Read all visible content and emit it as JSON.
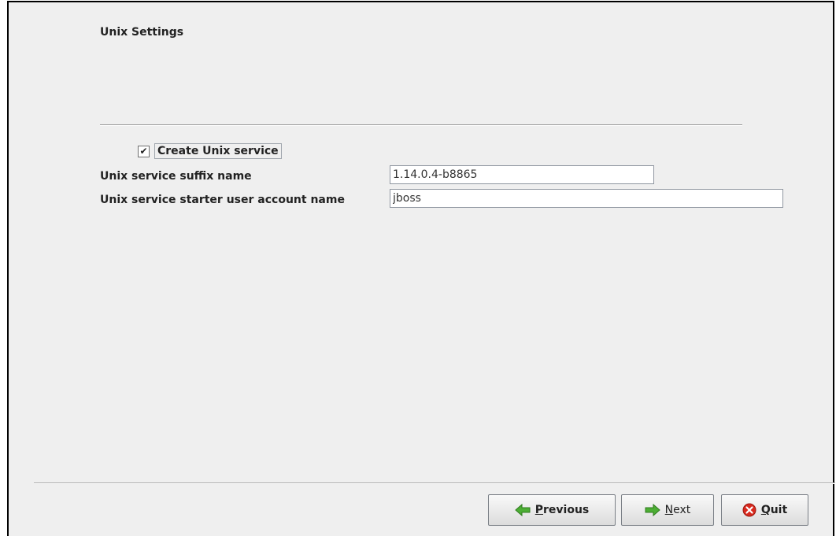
{
  "panel": {
    "title": "Unix Settings"
  },
  "create_service": {
    "checked": true,
    "check_glyph": "✔",
    "label": "Create Unix service"
  },
  "suffix": {
    "label": "Unix service suffix name",
    "value": "1.14.0.4-b8865"
  },
  "user": {
    "label": "Unix service starter user account name",
    "value": "jboss"
  },
  "buttons": {
    "previous": "Previous",
    "next": "Next",
    "quit": "Quit"
  },
  "icons": {
    "previous": "left-arrow-icon",
    "next": "right-arrow-icon",
    "quit": "stop-x-icon"
  },
  "colors": {
    "arrow_green": "#4cae34",
    "quit_red": "#d8291e"
  }
}
